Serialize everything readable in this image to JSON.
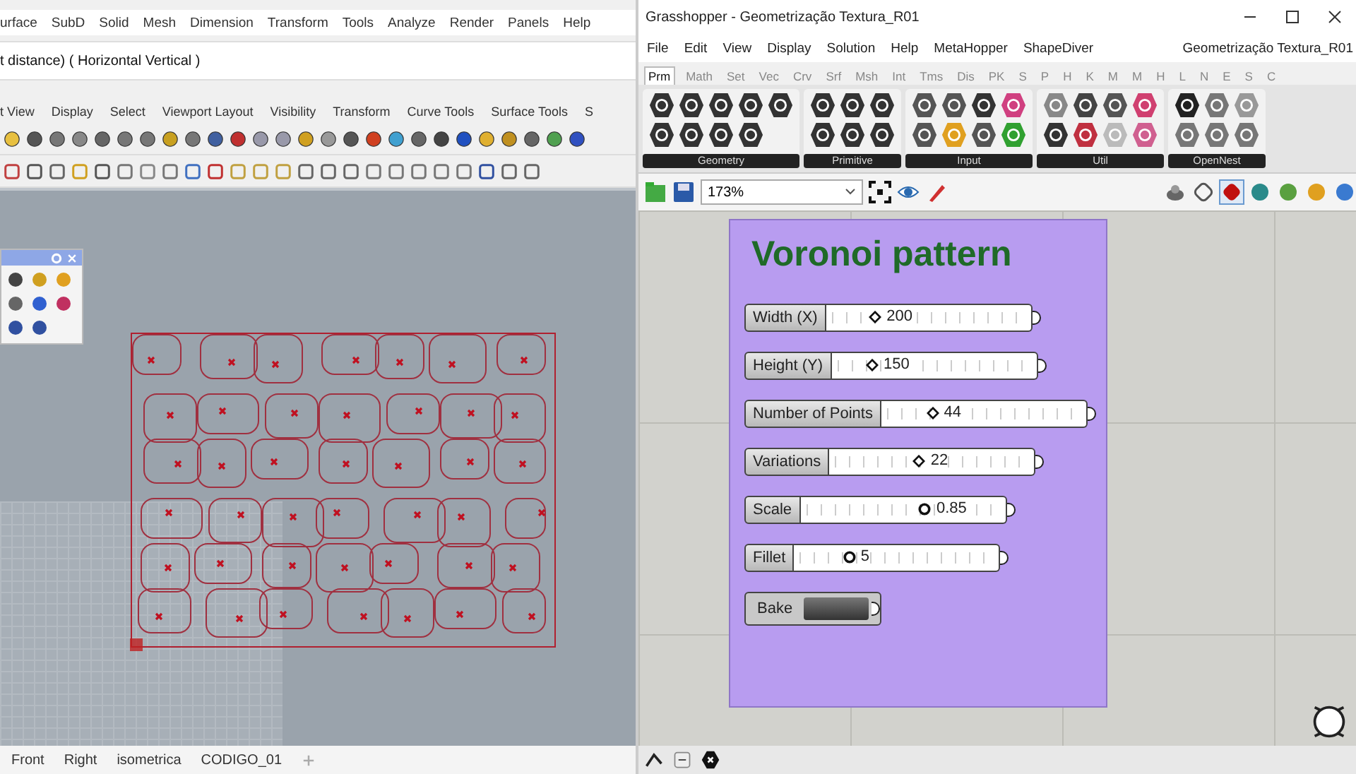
{
  "rhino": {
    "menu": [
      "urface",
      "SubD",
      "Solid",
      "Mesh",
      "Dimension",
      "Transform",
      "Tools",
      "Analyze",
      "Render",
      "Panels",
      "Help"
    ],
    "command_line": "t distance) ( Horizontal  Vertical )",
    "toolbar_tabs": [
      "t View",
      "Display",
      "Select",
      "Viewport Layout",
      "Visibility",
      "Transform",
      "Curve Tools",
      "Surface Tools",
      "S"
    ],
    "viewport_tabs": [
      "Front",
      "Right",
      "isometrica",
      "CODIGO_01"
    ]
  },
  "grasshopper": {
    "title": "Grasshopper - Geometrização Textura_R01",
    "menu": [
      "File",
      "Edit",
      "View",
      "Display",
      "Solution",
      "Help",
      "MetaHopper",
      "ShapeDiver"
    ],
    "document_name": "Geometrização Textura_R01",
    "tabs": [
      {
        "label": "Prm",
        "selected": true
      },
      {
        "label": "Math",
        "selected": false
      },
      {
        "label": "Set",
        "selected": false
      },
      {
        "label": "Vec",
        "selected": false
      },
      {
        "label": "Crv",
        "selected": false
      },
      {
        "label": "Srf",
        "selected": false
      },
      {
        "label": "Msh",
        "selected": false
      },
      {
        "label": "Int",
        "selected": false
      },
      {
        "label": "Tms",
        "selected": false
      },
      {
        "label": "Dis",
        "selected": false
      },
      {
        "label": "PK",
        "selected": false
      },
      {
        "label": "S",
        "selected": false
      },
      {
        "label": "P",
        "selected": false
      },
      {
        "label": "H",
        "selected": false
      },
      {
        "label": "K",
        "selected": false
      },
      {
        "label": "M",
        "selected": false
      },
      {
        "label": "M",
        "selected": false
      },
      {
        "label": "H",
        "selected": false
      },
      {
        "label": "L",
        "selected": false
      },
      {
        "label": "N",
        "selected": false
      },
      {
        "label": "E",
        "selected": false
      },
      {
        "label": "S",
        "selected": false
      },
      {
        "label": "C",
        "selected": false
      }
    ],
    "panels": [
      "Geometry",
      "Primitive",
      "Input",
      "Util",
      "OpenNest"
    ],
    "zoom": "173%",
    "group": {
      "title": "Voronoi pattern",
      "items": [
        {
          "kind": "integer",
          "label": "Width (X)",
          "value": "200",
          "level": 0.24
        },
        {
          "kind": "integer",
          "label": "Height (Y)",
          "value": "150",
          "level": 0.2
        },
        {
          "kind": "integer",
          "label": "Number of Points",
          "value": "44",
          "level": 0.25
        },
        {
          "kind": "integer",
          "label": "Variations",
          "value": "22",
          "level": 0.44
        },
        {
          "kind": "decimal",
          "label": "Scale",
          "value": "0.85",
          "level": 0.61
        },
        {
          "kind": "decimal",
          "label": "Fillet",
          "value": "5",
          "level": 0.27
        },
        {
          "kind": "button",
          "label": "Bake"
        }
      ]
    }
  }
}
